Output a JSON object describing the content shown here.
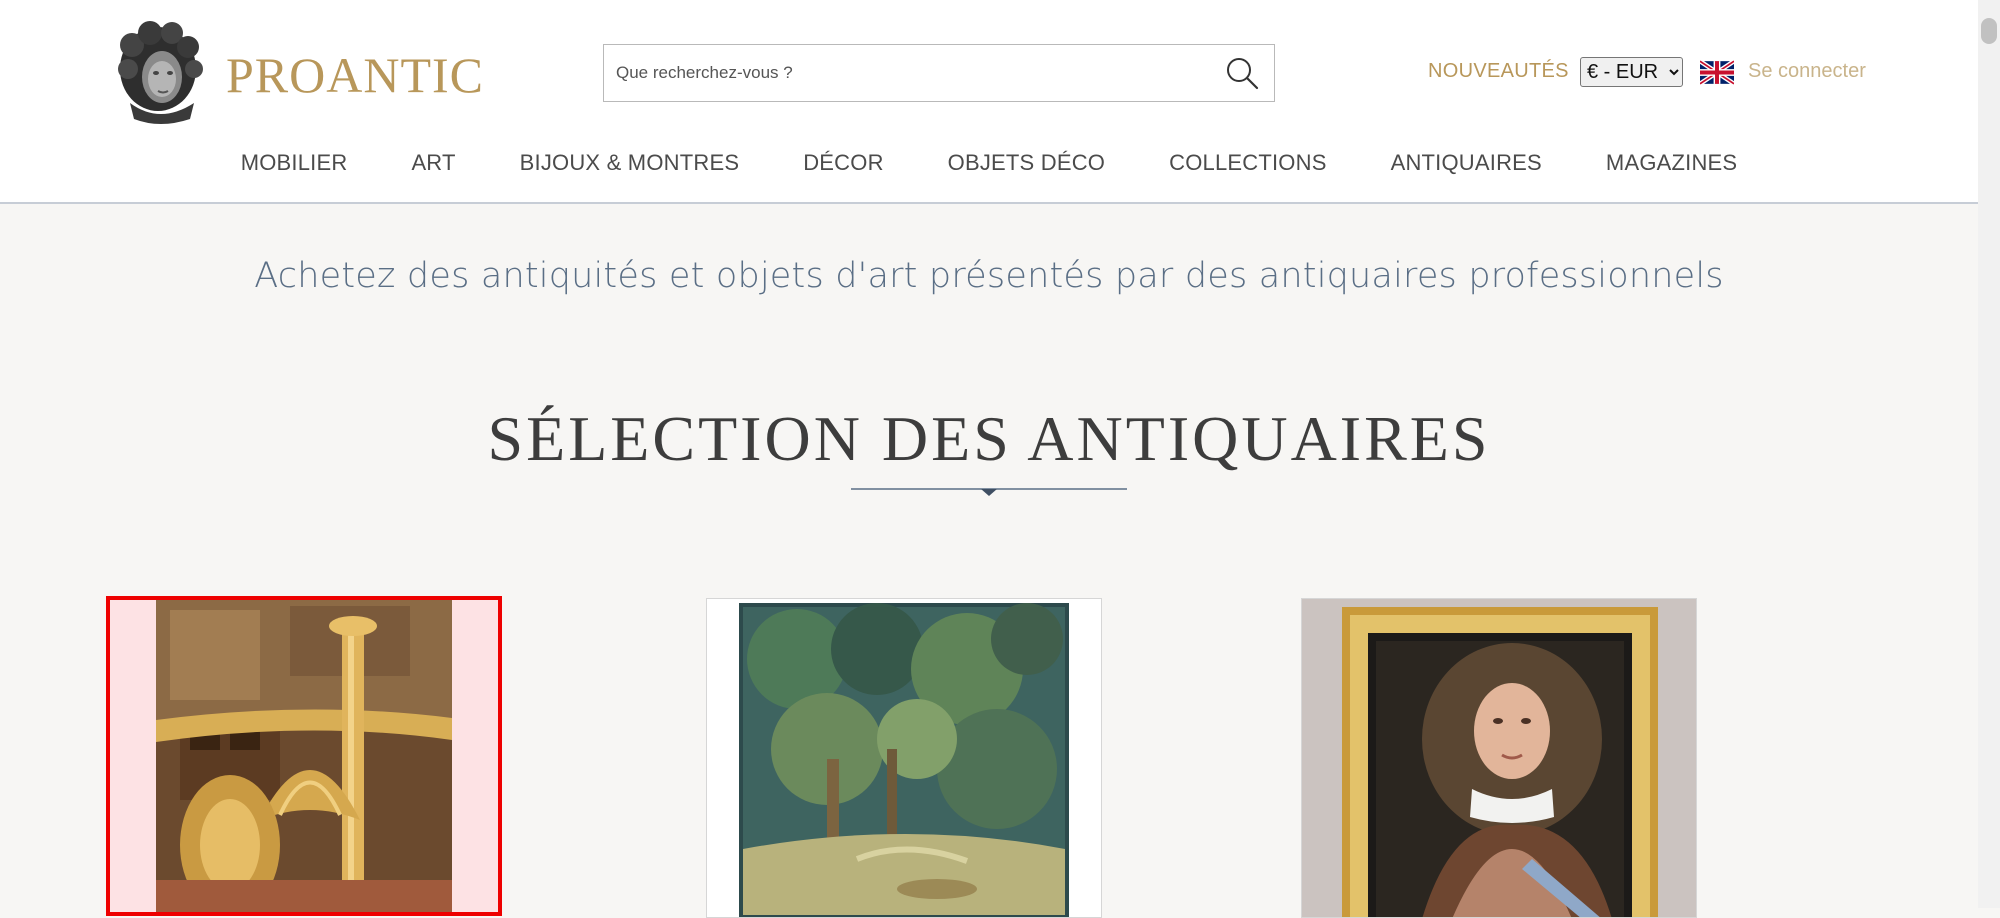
{
  "header": {
    "logo_text": "PROANTIC",
    "search": {
      "placeholder": "Que recherchez-vous ?",
      "value": ""
    },
    "nouveautes_label": "NOUVEAUTÉS",
    "currency": {
      "selected": "€ - EUR"
    },
    "language_flag": "uk-flag-icon",
    "login_label": "Se connecter"
  },
  "nav": {
    "items": [
      {
        "label": "MOBILIER"
      },
      {
        "label": "ART"
      },
      {
        "label": "BIJOUX & MONTRES"
      },
      {
        "label": "DÉCOR"
      },
      {
        "label": "OBJETS DÉCO"
      },
      {
        "label": "COLLECTIONS"
      },
      {
        "label": "ANTIQUAIRES"
      },
      {
        "label": "MAGAZINES"
      }
    ]
  },
  "main": {
    "tagline": "Achetez des antiquités et objets d'art présentés par des antiquaires professionnels",
    "section_title": "SÉLECTION DES ANTIQUAIRES",
    "cards": [
      {
        "image": "gilt-bronze-candlestick-image",
        "selected": true
      },
      {
        "image": "verdure-tapestry-image",
        "selected": false
      },
      {
        "image": "royal-portrait-painting-image",
        "selected": false
      }
    ]
  },
  "colors": {
    "brand_gold": "#b8975a",
    "tagline_blue": "#5a6e85",
    "selection_red": "#ee0000",
    "page_background": "#f7f6f4"
  }
}
